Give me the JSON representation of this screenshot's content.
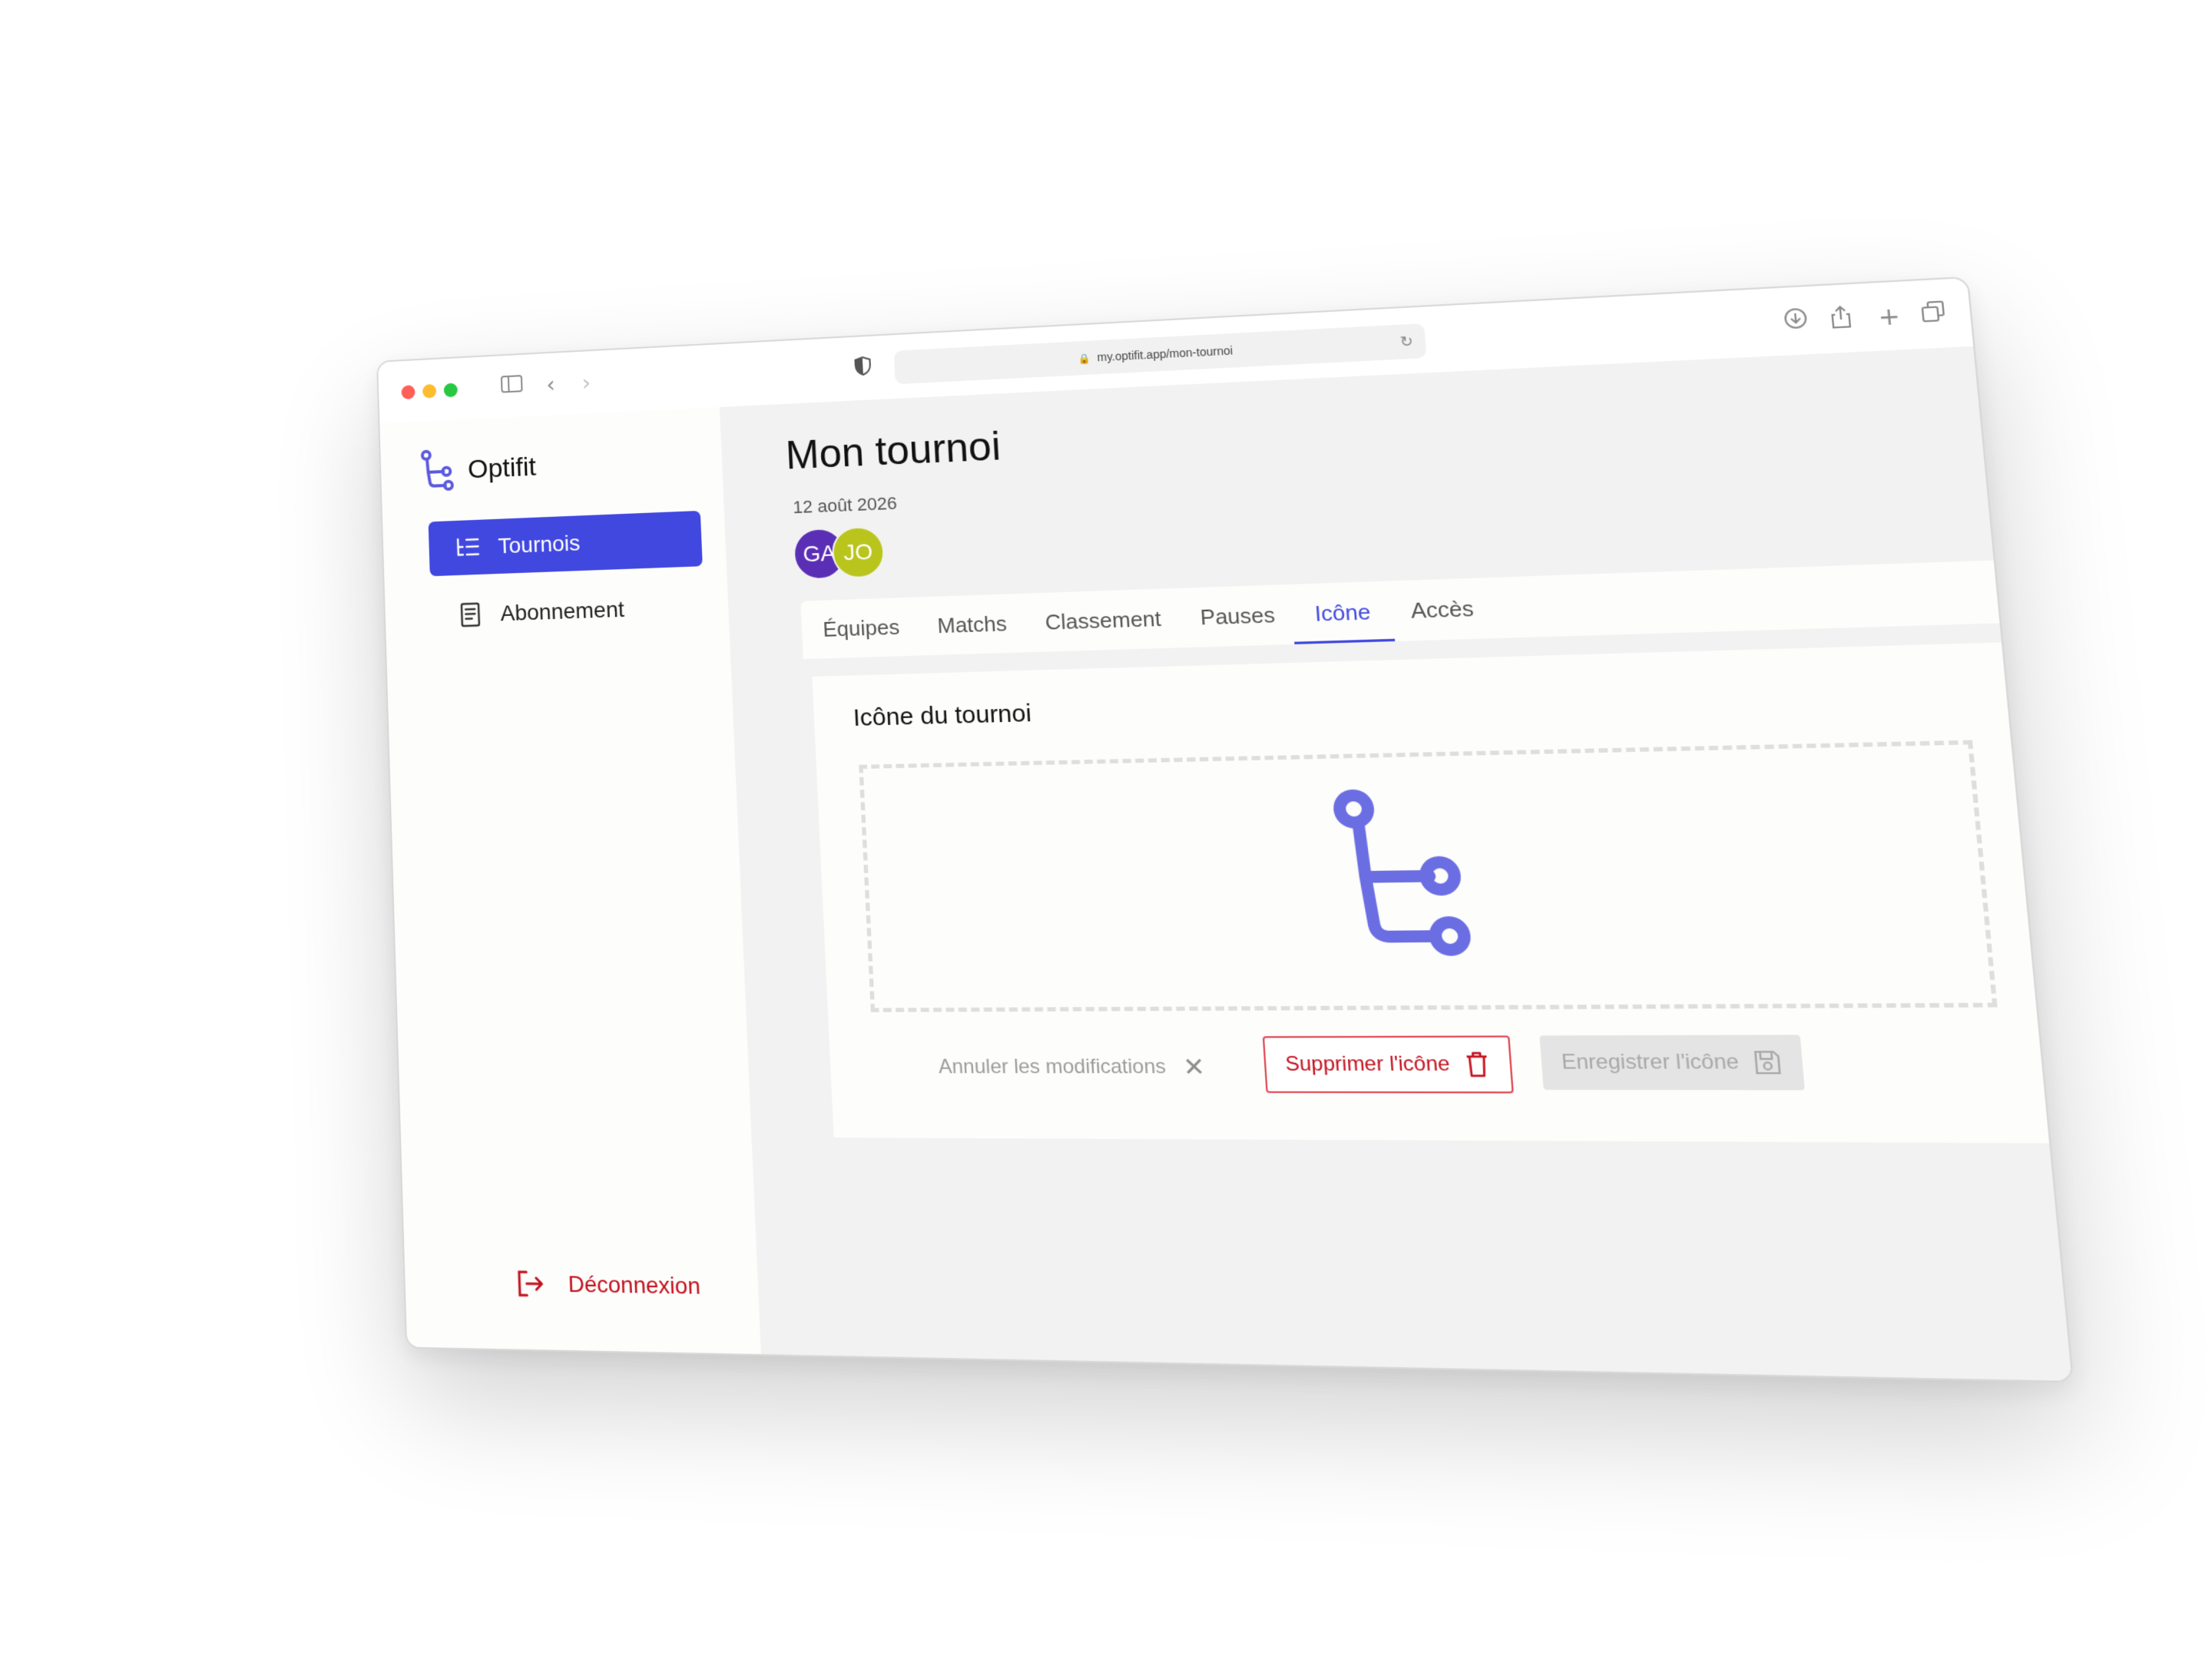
{
  "browser": {
    "url": "my.optifit.app/mon-tournoi"
  },
  "app": {
    "name": "Optifit",
    "accent_color": "#4148e0",
    "danger_color": "#c4101d"
  },
  "sidebar": {
    "items": [
      {
        "label": "Tournois",
        "icon": "list-tree-icon",
        "active": true
      },
      {
        "label": "Abonnement",
        "icon": "receipt-icon",
        "active": false
      }
    ],
    "logout_label": "Déconnexion"
  },
  "page": {
    "title": "Mon tournoi",
    "date": "12 août 2026",
    "avatars": [
      {
        "initials": "GA",
        "color": "#5b2fb5"
      },
      {
        "initials": "JO",
        "color": "#b9c51c"
      }
    ]
  },
  "tabs": [
    {
      "label": "Équipes",
      "active": false
    },
    {
      "label": "Matchs",
      "active": false
    },
    {
      "label": "Classement",
      "active": false
    },
    {
      "label": "Pauses",
      "active": false
    },
    {
      "label": "Icône",
      "active": true
    },
    {
      "label": "Accès",
      "active": false
    }
  ],
  "icon_card": {
    "title": "Icône du tournoi",
    "preview_icon": "optifit-logo-icon",
    "cancel_label": "Annuler les modifications",
    "delete_label": "Supprimer l'icône",
    "save_label": "Enregistrer l'icône"
  }
}
